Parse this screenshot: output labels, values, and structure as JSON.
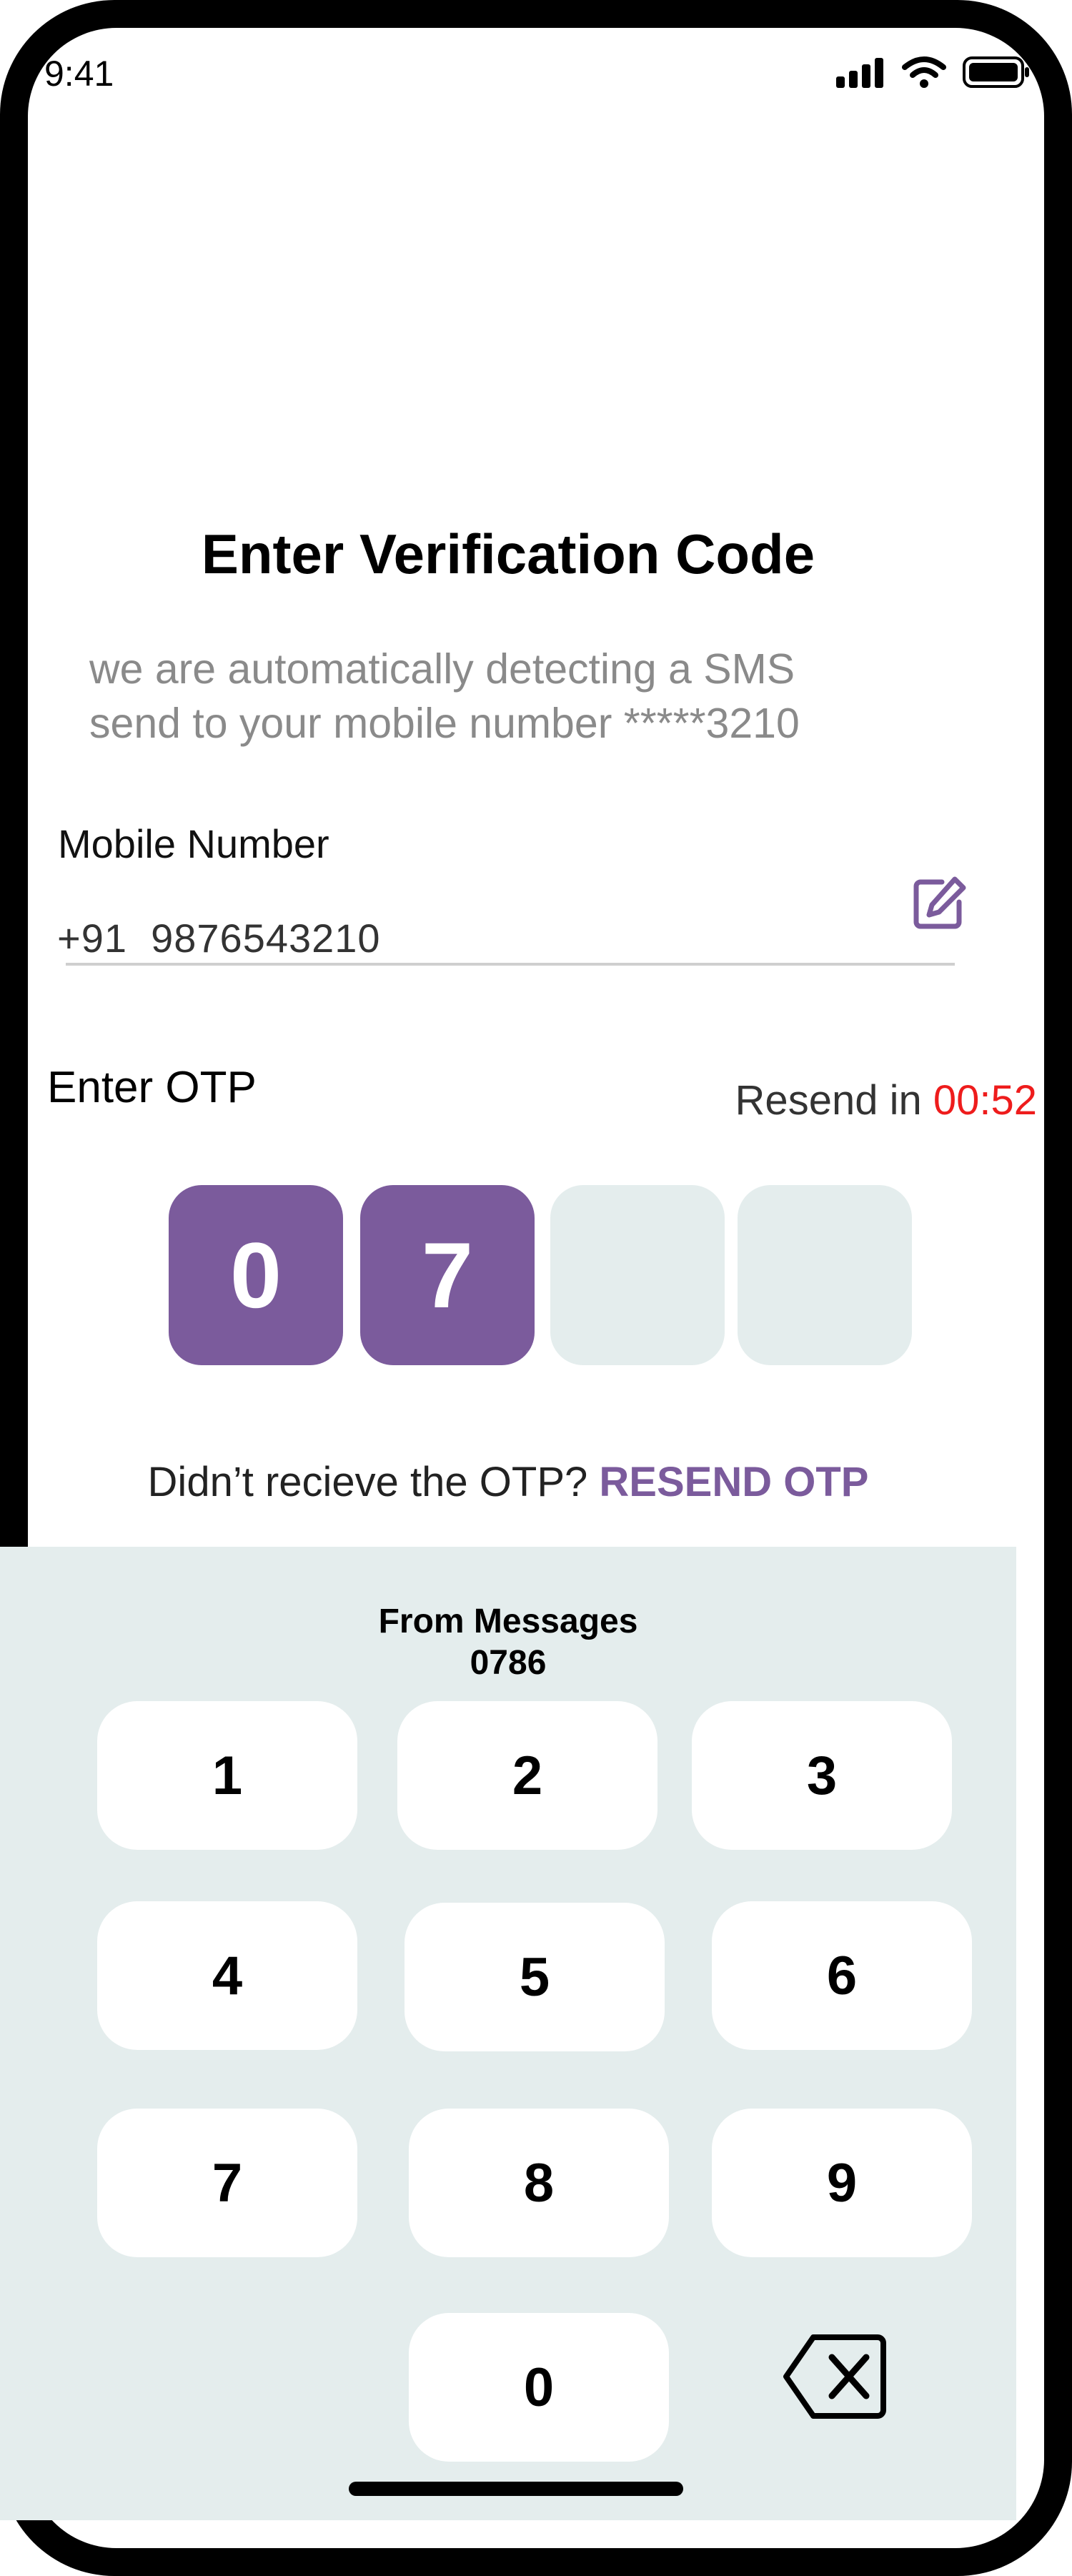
{
  "status": {
    "time": "9:41"
  },
  "title": "Enter Verification Code",
  "subtitle_line1": "we are automatically detecting a SMS",
  "subtitle_line2": "send to your mobile number *****3210",
  "mobile": {
    "label": "Mobile Number",
    "value": "+91  9876543210"
  },
  "otp": {
    "label": "Enter OTP",
    "resend_prefix": "Resend in ",
    "timer": "00:52",
    "digits": [
      "0",
      "7",
      "",
      ""
    ],
    "didnt_receive": "Didn’t recieve the OTP? ",
    "resend_link": "RESEND OTP"
  },
  "keyboard": {
    "suggestion_source": "From Messages",
    "suggestion_code": "0786",
    "keys": [
      "1",
      "2",
      "3",
      "4",
      "5",
      "6",
      "7",
      "8",
      "9",
      "0"
    ]
  },
  "colors": {
    "accent": "#7b5b9c",
    "timer": "#ee1c1c",
    "keyboard_bg": "#e4eded"
  }
}
